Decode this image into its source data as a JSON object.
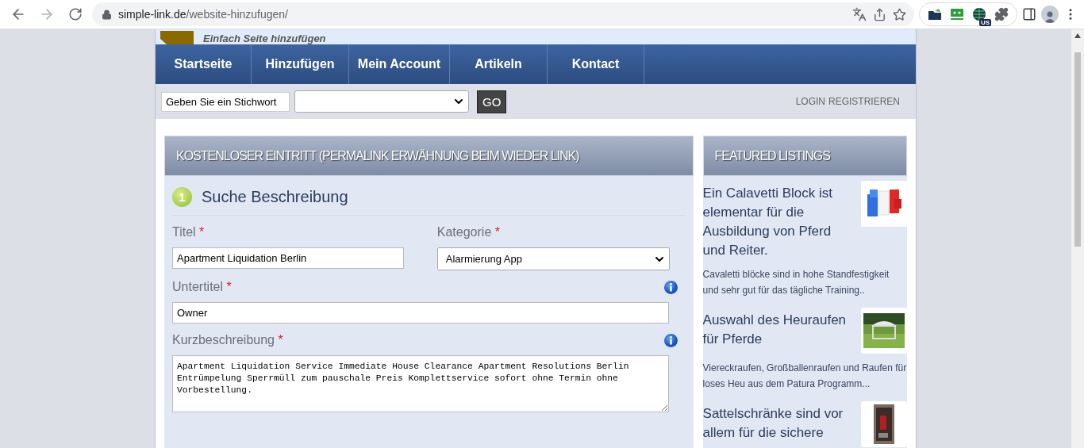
{
  "browser": {
    "url_host": "simple-link.de",
    "url_path": "/website-hinzufugen/",
    "forward_disabled": true,
    "extension_badge": "US"
  },
  "banner": {
    "tagline": "Einfach Seite hinzufügen"
  },
  "nav": [
    {
      "label": "Startseite"
    },
    {
      "label": "Hinzufügen"
    },
    {
      "label": "Mein Account"
    },
    {
      "label": "Artikeln"
    },
    {
      "label": "Kontact"
    }
  ],
  "search": {
    "keyword": "Geben Sie ein Stichwort",
    "button": "GO"
  },
  "account_links": [
    "LOGIN",
    "REGISTRIEREN"
  ],
  "main": {
    "title": "KOSTENLOSER EINTRITT (PERMALINK ERWÄHNUNG BEIM WIEDER LINK)",
    "step": {
      "number": "1",
      "title": "Suche Beschreibung"
    },
    "rows": [
      [
        {
          "kind": "input",
          "label": "Titel",
          "required_mark": "*",
          "info": false,
          "value": "Apartment Liquidation Berlin"
        },
        {
          "kind": "select",
          "label": "Kategorie",
          "required_mark": "*",
          "info": false,
          "value": "Alarmierung App"
        }
      ],
      [
        {
          "kind": "input",
          "label": "Untertitel",
          "required_mark": "*",
          "info": true,
          "value": "Owner"
        }
      ],
      [
        {
          "kind": "textarea",
          "label": "Kurzbeschreibung",
          "required_mark": "*",
          "info": true,
          "value": "Apartment Liquidation Service Immediate House Clearance Apartment Resolutions Berlin Entrümpelung Sperrmüll zum pauschale Preis Komplettservice sofort ohne Termin ohne Vorbestellung."
        }
      ]
    ]
  },
  "sidebar": {
    "title": "FEATURED LISTINGS",
    "items": [
      {
        "title": "Ein Calavetti Block ist elementar für die Ausbildung von Pferd und Reiter.",
        "text": "Cavaletti blöcke sind in hohe Standfestigkeit und sehr gut für das tägliche Training.."
      },
      {
        "title": "Auswahl des Heuraufen für Pferde",
        "text": "Viereckraufen, Großballenraufen und Raufen für loses Heu aus dem Patura Programm..."
      },
      {
        "title": "Sattelschränke sind vor allem für die sichere"
      }
    ]
  }
}
